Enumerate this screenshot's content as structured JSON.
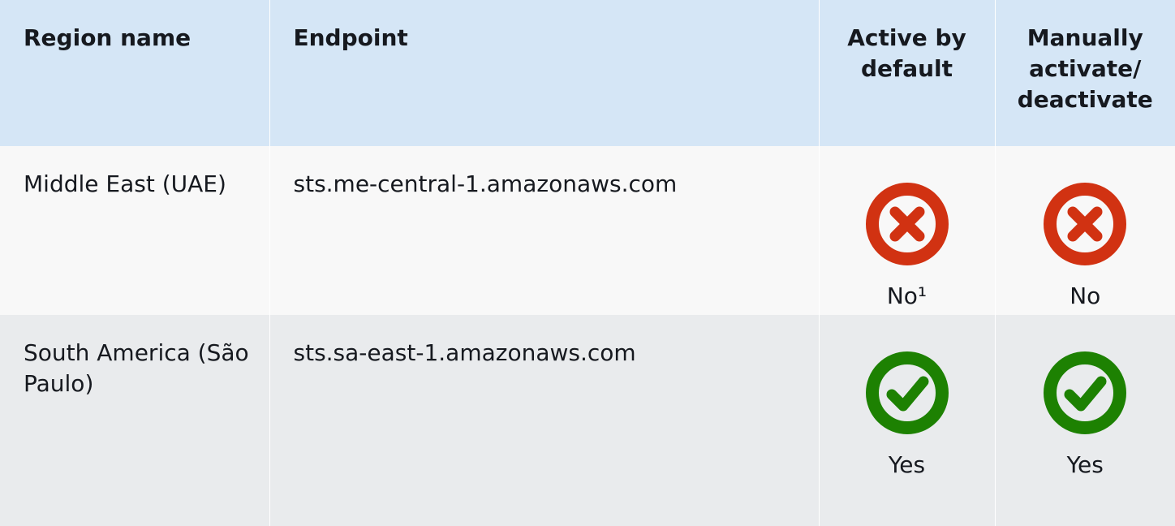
{
  "table": {
    "headers": [
      "Region name",
      "Endpoint",
      "Active by default",
      "Manually activate/ deactivate"
    ],
    "rows": [
      {
        "region": "Middle East (UAE)",
        "endpoint": "sts.me-central-1.amazonaws.com",
        "active_by_default": {
          "label": "No¹",
          "icon": "error-circle-icon",
          "color": "#d13212"
        },
        "manual_activation": {
          "label": "No",
          "icon": "error-circle-icon",
          "color": "#d13212"
        }
      },
      {
        "region": "South America (São Paulo)",
        "endpoint": "sts.sa-east-1.amazonaws.com",
        "active_by_default": {
          "label": "Yes",
          "icon": "success-circle-icon",
          "color": "#1d8102"
        },
        "manual_activation": {
          "label": "Yes",
          "icon": "success-circle-icon",
          "color": "#1d8102"
        }
      }
    ]
  },
  "colors": {
    "header_bg": "#d5e6f6",
    "row_light": "#f8f8f8",
    "row_dark": "#e9ebed",
    "text": "#16191f"
  }
}
